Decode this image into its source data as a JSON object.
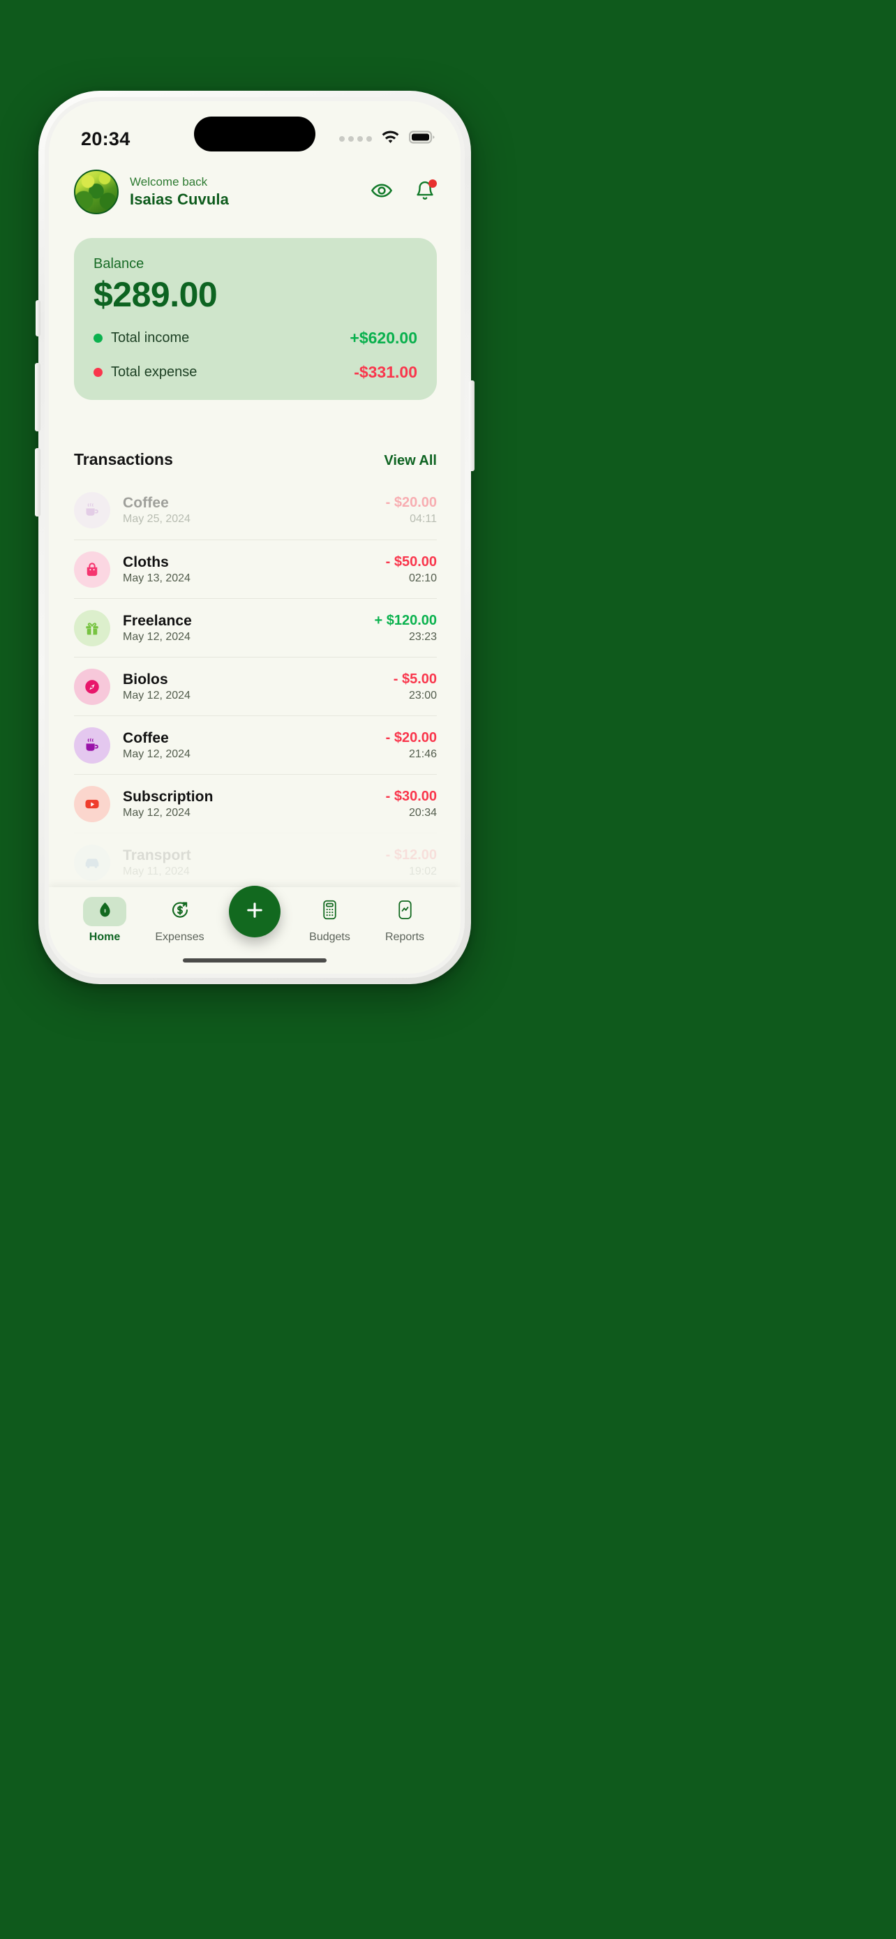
{
  "status_bar": {
    "time": "20:34",
    "signal_icon": "signal-dots-icon",
    "wifi_icon": "wifi-icon",
    "battery_icon": "battery-full-icon"
  },
  "header": {
    "avatar_name": "user-avatar",
    "greeting": "Welcome back",
    "user_name": "Isaias Cuvula",
    "eye_icon": "eye-icon",
    "bell_icon": "bell-icon",
    "has_notification": true
  },
  "balance": {
    "label": "Balance",
    "amount": "$289.00",
    "income_label": "Total income",
    "income_value": "+$620.00",
    "expense_label": "Total expense",
    "expense_value": "-$331.00",
    "income_color": "#09b04d",
    "expense_color": "#f9364c",
    "card_color": "#cfe5cb"
  },
  "transactions": {
    "title": "Transactions",
    "view_all": "View All",
    "items": [
      {
        "name": "Coffee",
        "date": "May 25, 2024",
        "amount": "- $20.00",
        "time": "04:11",
        "type": "expense",
        "icon": "coffee-cup-icon",
        "icon_bg": "#efe0f5",
        "icon_color": "#c48ad6",
        "state": "faded"
      },
      {
        "name": "Cloths",
        "date": "May 13, 2024",
        "amount": "- $50.00",
        "time": "02:10",
        "type": "expense",
        "icon": "shopping-bag-icon",
        "icon_bg": "#fbd7e2",
        "icon_color": "#f5346f",
        "state": "normal"
      },
      {
        "name": "Freelance",
        "date": "May 12, 2024",
        "amount": "+ $120.00",
        "time": "23:23",
        "type": "income",
        "icon": "gift-icon",
        "icon_bg": "#dcefcc",
        "icon_color": "#77c341",
        "state": "normal"
      },
      {
        "name": "Biolos",
        "date": "May 12, 2024",
        "amount": "- $5.00",
        "time": "23:00",
        "type": "expense",
        "icon": "compass-icon",
        "icon_bg": "#f7c8da",
        "icon_color": "#e8176b",
        "state": "normal"
      },
      {
        "name": "Coffee",
        "date": "May 12, 2024",
        "amount": "- $20.00",
        "time": "21:46",
        "type": "expense",
        "icon": "coffee-cup-icon",
        "icon_bg": "#e4c8ef",
        "icon_color": "#9912a8",
        "state": "normal"
      },
      {
        "name": "Subscription",
        "date": "May 12, 2024",
        "amount": "- $30.00",
        "time": "20:34",
        "type": "expense",
        "icon": "play-video-icon",
        "icon_bg": "#fbd6cd",
        "icon_color": "#ef3d2c",
        "state": "normal"
      },
      {
        "name": "Transport",
        "date": "May 11, 2024",
        "amount": "- $12.00",
        "time": "19:02",
        "type": "expense",
        "icon": "car-icon",
        "icon_bg": "#dce9f5",
        "icon_color": "#3d7fc4",
        "state": "cut"
      }
    ]
  },
  "bottom_nav": {
    "items": [
      {
        "label": "Home",
        "icon": "home-icon",
        "active": true
      },
      {
        "label": "Expenses",
        "icon": "dollar-arrow-icon",
        "active": false
      },
      {
        "label": "Budgets",
        "icon": "calculator-icon",
        "active": false
      },
      {
        "label": "Reports",
        "icon": "line-chart-icon",
        "active": false
      }
    ],
    "fab": {
      "label": "+",
      "icon": "plus-icon",
      "color": "#12691f"
    }
  },
  "theme": {
    "background": "#0f5a1c",
    "screen_bg": "#f7f8f0",
    "primary_green": "#0d6321"
  }
}
